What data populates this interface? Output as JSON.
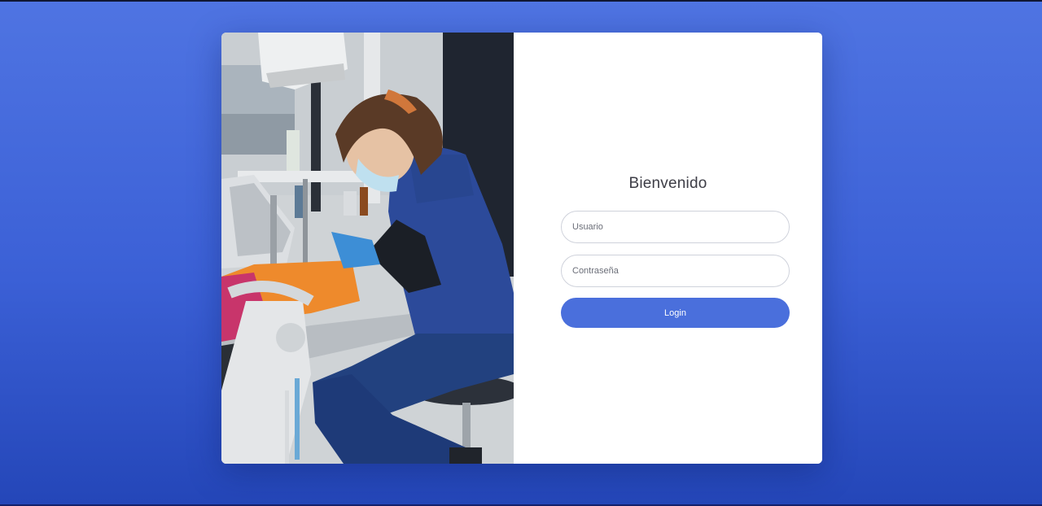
{
  "login": {
    "title": "Bienvenido",
    "username_placeholder": "Usuario",
    "password_placeholder": "Contraseña",
    "button_label": "Login"
  },
  "colors": {
    "background_top": "#4f74e2",
    "background_bottom": "#2446b8",
    "card": "#ffffff",
    "accent": "#4a6fdc"
  }
}
